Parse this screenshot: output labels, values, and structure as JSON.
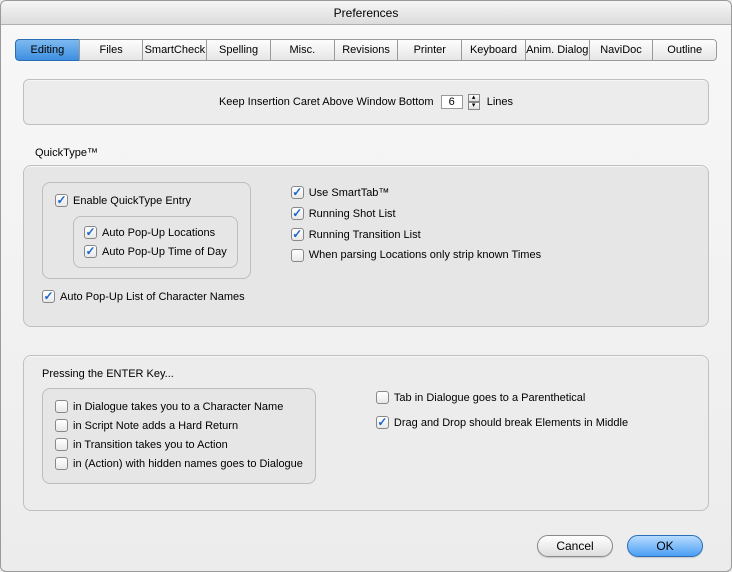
{
  "window_title": "Preferences",
  "tabs": [
    "Editing",
    "Files",
    "SmartCheck",
    "Spelling",
    "Misc.",
    "Revisions",
    "Printer",
    "Keyboard",
    "Anim. Dialog",
    "NaviDoc",
    "Outline"
  ],
  "caret": {
    "label_left": "Keep Insertion Caret Above Window Bottom",
    "value": "6",
    "label_right": "Lines"
  },
  "quicktype": {
    "heading": "QuickType™",
    "enable": {
      "checked": true,
      "label": "Enable QuickType Entry"
    },
    "popup_locations": {
      "checked": true,
      "label": "Auto Pop-Up Locations"
    },
    "popup_tod": {
      "checked": true,
      "label": "Auto Pop-Up Time of Day"
    },
    "popup_chars": {
      "checked": true,
      "label": "Auto Pop-Up List of Character Names"
    },
    "smarttab": {
      "checked": true,
      "label": "Use SmartTab™"
    },
    "shotlist": {
      "checked": true,
      "label": "Running Shot List"
    },
    "translist": {
      "checked": true,
      "label": "Running Transition List"
    },
    "parse_times": {
      "checked": false,
      "label": "When parsing Locations only strip known Times"
    }
  },
  "enter": {
    "heading": "Pressing the ENTER Key...",
    "dlg_to_char": {
      "checked": false,
      "label": "in Dialogue takes you to a Character Name"
    },
    "scriptnote_hr": {
      "checked": false,
      "label": "in Script Note adds a Hard Return"
    },
    "trans_to_action": {
      "checked": false,
      "label": "in Transition takes you to Action"
    },
    "action_to_dlg": {
      "checked": false,
      "label": "in (Action) with hidden names goes to Dialogue"
    },
    "tab_paren": {
      "checked": false,
      "label": "Tab in Dialogue goes to a Parenthetical"
    },
    "drag_break": {
      "checked": true,
      "label": "Drag and Drop should break Elements in Middle"
    }
  },
  "buttons": {
    "cancel": "Cancel",
    "ok": "OK"
  }
}
